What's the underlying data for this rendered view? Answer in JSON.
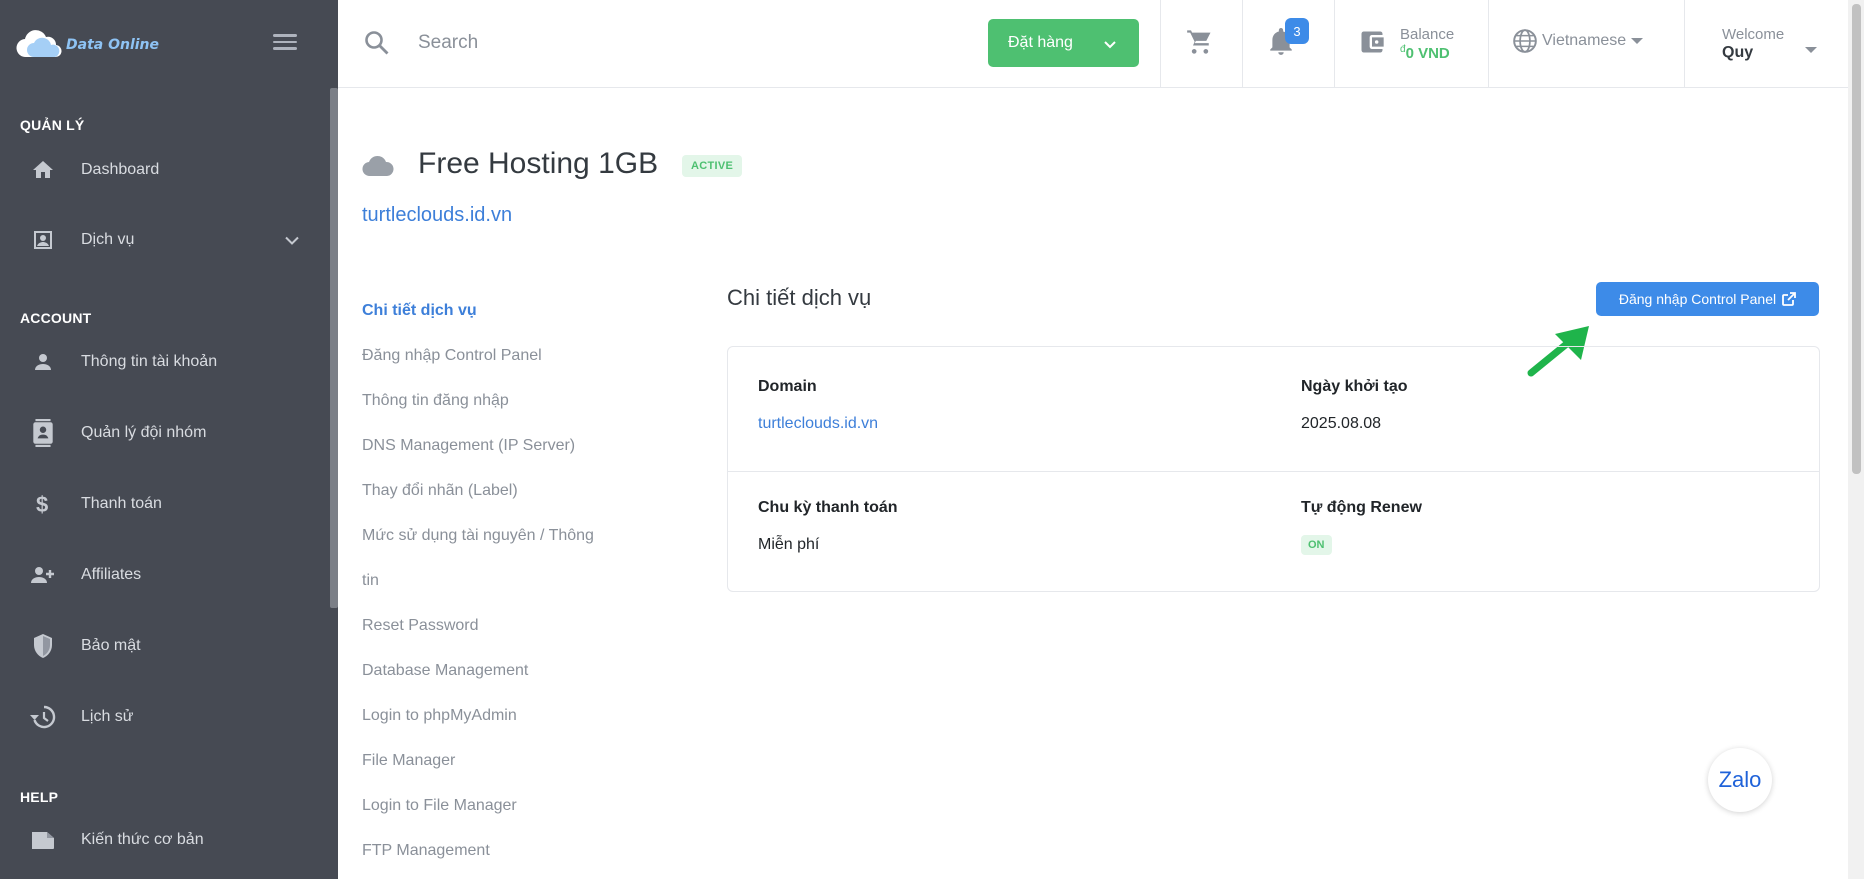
{
  "brand": {
    "name": "Data Online"
  },
  "sidebar": {
    "sections": [
      "QUẢN LÝ",
      "ACCOUNT",
      "HELP"
    ],
    "items": [
      {
        "label": "Dashboard",
        "icon": "home-icon"
      },
      {
        "label": "Dịch vụ",
        "icon": "service-icon"
      },
      {
        "label": "Thông tin tài khoản",
        "icon": "user-icon"
      },
      {
        "label": "Quản lý đội nhóm",
        "icon": "contacts-icon"
      },
      {
        "label": "Thanh toán",
        "icon": "dollar-icon"
      },
      {
        "label": "Affiliates",
        "icon": "user-plus-icon"
      },
      {
        "label": "Bảo mật",
        "icon": "shield-icon"
      },
      {
        "label": "Lịch sử",
        "icon": "history-icon"
      },
      {
        "label": "Kiến thức cơ bản",
        "icon": "book-icon"
      }
    ]
  },
  "header": {
    "search_placeholder": "Search",
    "order_button": "Đặt hàng",
    "notification_count": "3",
    "balance_label": "Balance",
    "balance_currency": "đ",
    "balance_value": "0 VND",
    "language": "Vietnamese",
    "welcome_label": "Welcome",
    "user_name": "Quy"
  },
  "service": {
    "title": "Free Hosting 1GB",
    "status": "ACTIVE",
    "domain": "turtleclouds.id.vn"
  },
  "subnav": [
    "Chi tiết dịch vụ",
    "Đăng nhập Control Panel",
    "Thông tin đăng nhập",
    "DNS Management (IP Server)",
    "Thay đổi nhãn (Label)",
    "Mức sử dụng tài nguyên / Thông",
    "tin",
    "Reset Password",
    "Database Management",
    "Login to phpMyAdmin",
    "File Manager",
    "Login to File Manager",
    "FTP Management"
  ],
  "details": {
    "section_title": "Chi tiết dịch vụ",
    "cp_button": "Đăng nhập Control Panel",
    "domain_label": "Domain",
    "domain_value": "turtleclouds.id.vn",
    "created_label": "Ngày khởi tạo",
    "created_value": "2025.08.08",
    "cycle_label": "Chu kỳ thanh toán",
    "cycle_value": "Miễn phí",
    "renew_label": "Tự động Renew",
    "renew_value": "ON"
  },
  "chat_widget": {
    "label": "Zalo"
  },
  "colors": {
    "sidebar_bg": "#464a53",
    "primary": "#3d8be8",
    "success": "#4ec071"
  }
}
